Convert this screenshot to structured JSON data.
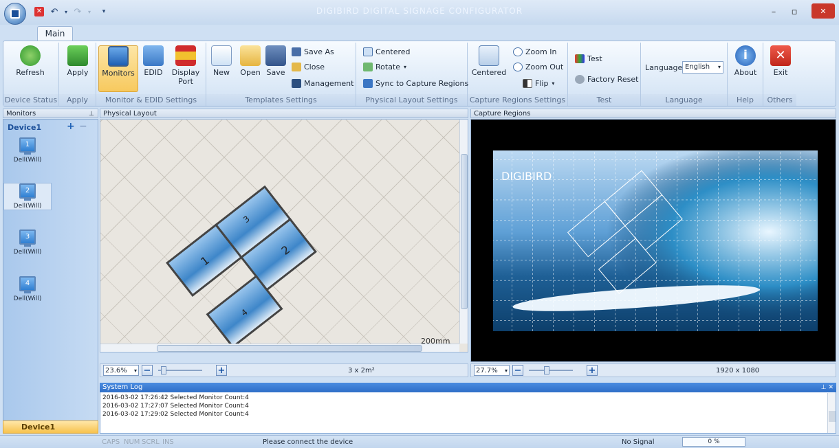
{
  "window": {
    "title": "DIGIBIRD DIGITAL SIGNAGE CONFIGURATOR",
    "minimize": "–",
    "restore": "▫",
    "close": "✕"
  },
  "tabs": [
    {
      "label": "Main"
    }
  ],
  "ribbon": {
    "device_status": {
      "group": "Device Status",
      "refresh": "Refresh"
    },
    "apply": {
      "group": "Apply",
      "apply": "Apply"
    },
    "monitor_edid": {
      "group": "Monitor & EDID Settings",
      "monitors": "Monitors",
      "edid": "EDID",
      "display_port_1": "Display",
      "display_port_2": "Port"
    },
    "templates": {
      "group": "Templates Settings",
      "new": "New",
      "open": "Open",
      "save": "Save",
      "save_as": "Save As",
      "close": "Close",
      "management": "Management"
    },
    "physical_layout": {
      "group": "Physical Layout Settings",
      "centered": "Centered",
      "rotate": "Rotate",
      "sync": "Sync to Capture Regions"
    },
    "capture_regions": {
      "group": "Capture Regions Settings",
      "centered": "Centered",
      "zoom_in": "Zoom In",
      "zoom_out": "Zoom Out",
      "flip": "Flip"
    },
    "test": {
      "group": "Test",
      "test": "Test",
      "factory_reset": "Factory Reset"
    },
    "language": {
      "group": "Language",
      "label": "Language",
      "value": "English"
    },
    "help": {
      "group": "Help",
      "about": "About"
    },
    "others": {
      "group": "Others",
      "exit": "Exit"
    }
  },
  "monitors_panel": {
    "title": "Monitors",
    "device": "Device1",
    "items": [
      {
        "number": "1",
        "label": "Dell(Will)"
      },
      {
        "number": "2",
        "label": "Dell(Will)"
      },
      {
        "number": "3",
        "label": "Dell(Will)"
      },
      {
        "number": "4",
        "label": "Dell(Will)"
      }
    ],
    "footer_tab": "Device1"
  },
  "physical_layout": {
    "title": "Physical Layout",
    "scale_label": "200mm",
    "zoom": "23.6%",
    "area": "3 x 2m²",
    "panels": [
      "1",
      "2",
      "3",
      "4"
    ]
  },
  "capture_regions": {
    "title": "Capture Regions",
    "logo": "DIGIBIRD",
    "zoom": "27.7%",
    "resolution": "1920 x 1080"
  },
  "system_log": {
    "title": "System Log",
    "lines": [
      "2016-03-02 17:26:42 Selected Monitor Count:4",
      "2016-03-02 17:27:07 Selected Monitor Count:4",
      "2016-03-02 17:29:02 Selected Monitor Count:4"
    ]
  },
  "status": {
    "caps": "CAPS",
    "num": "NUM",
    "scrl": "SCRL",
    "ins": "INS",
    "message": "Please connect the device",
    "signal": "No Signal",
    "progress": "0 %"
  }
}
